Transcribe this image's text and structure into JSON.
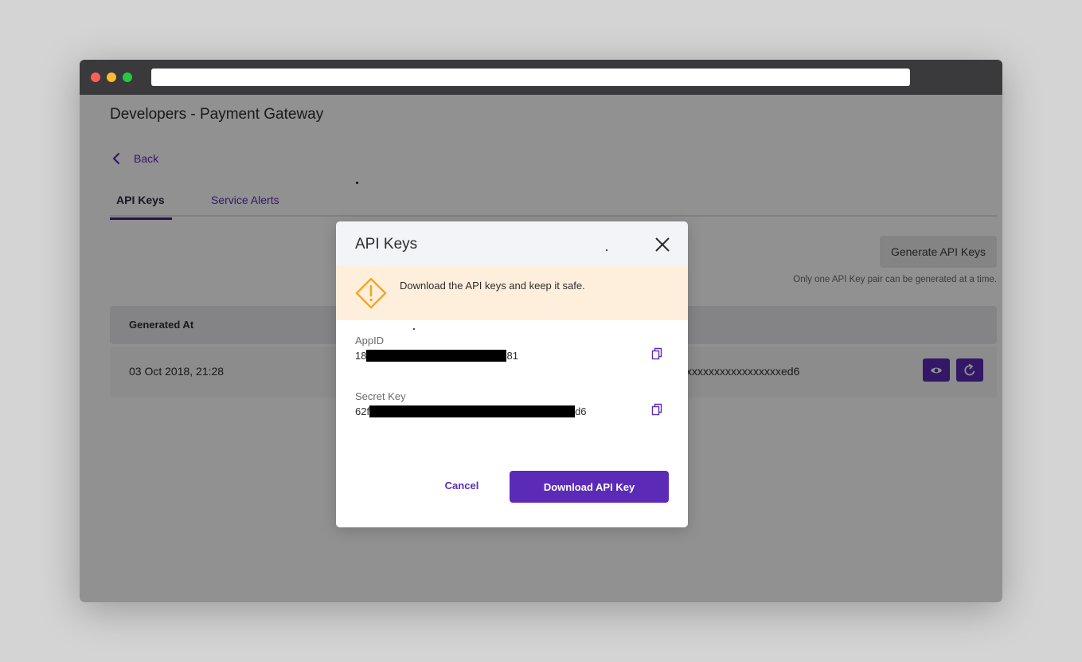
{
  "browser": {
    "url": ""
  },
  "page": {
    "title": "Developers - Payment Gateway",
    "back_label": "Back",
    "tabs": [
      {
        "label": "API Keys",
        "active": true
      },
      {
        "label": "Service Alerts",
        "active": false
      }
    ],
    "generate_button_label": "Generate API Keys",
    "generate_hint": "Only one API Key pair can be generated at a time.",
    "table": {
      "headers": [
        "Generated At"
      ],
      "rows": [
        {
          "generated_at": "03 Oct 2018, 21:28",
          "key_visible_tail": "xxxxxxxxxxxxxxxxxed6"
        }
      ]
    }
  },
  "modal": {
    "title": "API Keys",
    "alert_message": "Download the API keys and keep it safe.",
    "app_id": {
      "label": "AppID",
      "prefix": "18",
      "suffix": "81"
    },
    "secret_key": {
      "label": "Secret Key",
      "prefix": "62f",
      "suffix": "d6"
    },
    "cancel_label": "Cancel",
    "download_label": "Download API Key"
  },
  "colors": {
    "accent": "#5b2bb8",
    "alert_background": "#fdefdc",
    "warning_icon": "#f5a623",
    "titlebar": "#3a3a3c"
  },
  "icons": [
    "chevron-left-icon",
    "close-icon",
    "warning-icon",
    "copy-icon",
    "eye-icon",
    "refresh-icon"
  ]
}
